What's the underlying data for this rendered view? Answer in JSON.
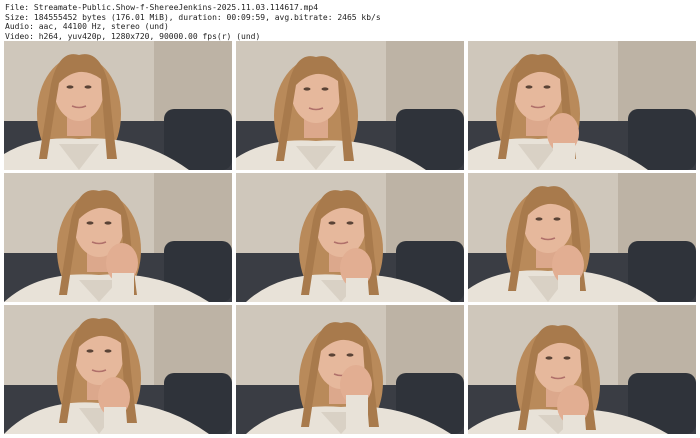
{
  "header": {
    "file_line": "File: Streamate-Public.Show-f-ShereeJenkins-2025.11.03.114617.mp4",
    "size_line": "Size: 184555452 bytes (176.01 MiB), duration: 00:09:59, avg.bitrate: 2465 kb/s",
    "audio_line": "Audio: aac, 44100 Hz, stereo (und)",
    "video_line": "Video: h264, yuv420p, 1280x720, 90000.00 fps(r) (und)"
  },
  "thumbnails": [
    {
      "pose": "looking-down-right"
    },
    {
      "pose": "looking-down-right"
    },
    {
      "pose": "hand-near-chin"
    },
    {
      "pose": "hand-over-mouth"
    },
    {
      "pose": "hand-over-mouth"
    },
    {
      "pose": "hand-on-chin"
    },
    {
      "pose": "hand-on-chin"
    },
    {
      "pose": "hand-on-face"
    },
    {
      "pose": "fist-on-cheek"
    }
  ]
}
